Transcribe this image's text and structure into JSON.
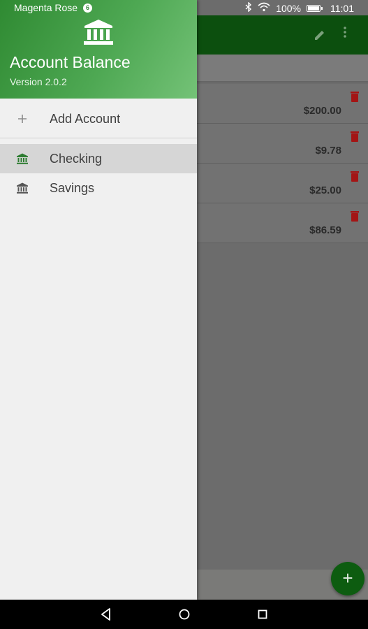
{
  "status_bar": {
    "carrier": "Magenta Rose",
    "badge": "6",
    "battery": "100%",
    "battery_level": 1.0,
    "time": "11:01"
  },
  "drawer": {
    "app_title": "Account Balance",
    "version": "Version 2.0.2",
    "add_account_label": "Add Account",
    "accounts": [
      {
        "label": "Checking",
        "selected": true
      },
      {
        "label": "Savings",
        "selected": false
      }
    ]
  },
  "background_list": {
    "amounts": [
      "$200.00",
      "$9.78",
      "$25.00",
      "$86.59"
    ]
  },
  "fab_label": "+",
  "icons": {
    "bank": "bank-icon",
    "add": "plus-icon",
    "edit": "pencil-icon",
    "more": "more-vert-icon",
    "delete": "trash-icon",
    "back": "back-icon",
    "home": "home-icon",
    "recents": "recents-icon"
  },
  "colors": {
    "primary_dark": "#0c4f0e",
    "primary": "#3a8a3c",
    "header_light": "#74c277",
    "delete_red": "#b71c1c",
    "selected_bg": "#d6d6d6"
  }
}
